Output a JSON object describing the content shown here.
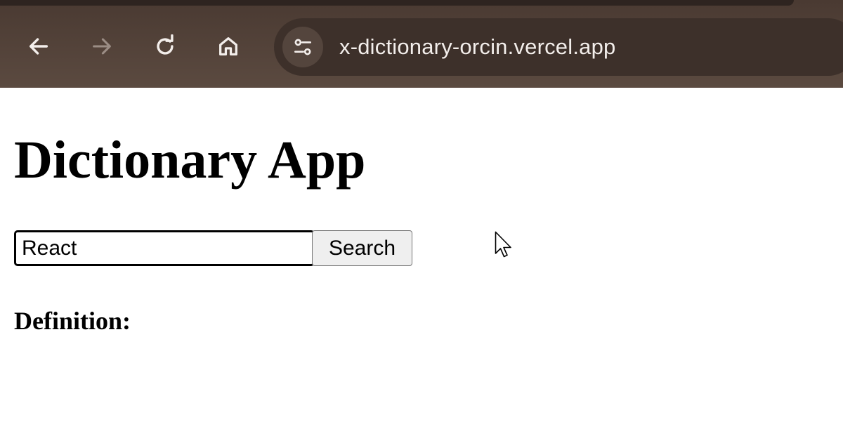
{
  "browser": {
    "url": "x-dictionary-orcin.vercel.app",
    "icons": {
      "back": "arrow-left-icon",
      "forward": "arrow-right-icon",
      "reload": "reload-icon",
      "home": "home-icon",
      "site_info": "tune-icon"
    },
    "colors": {
      "chrome_bg": "#4a3a32",
      "address_bar_bg": "#3d302a",
      "icon_active": "#f3eeeb",
      "icon_disabled": "#9b8d85"
    }
  },
  "page": {
    "title": "Dictionary App",
    "search": {
      "value": "React",
      "button_label": "Search"
    },
    "definition_label": "Definition:"
  }
}
